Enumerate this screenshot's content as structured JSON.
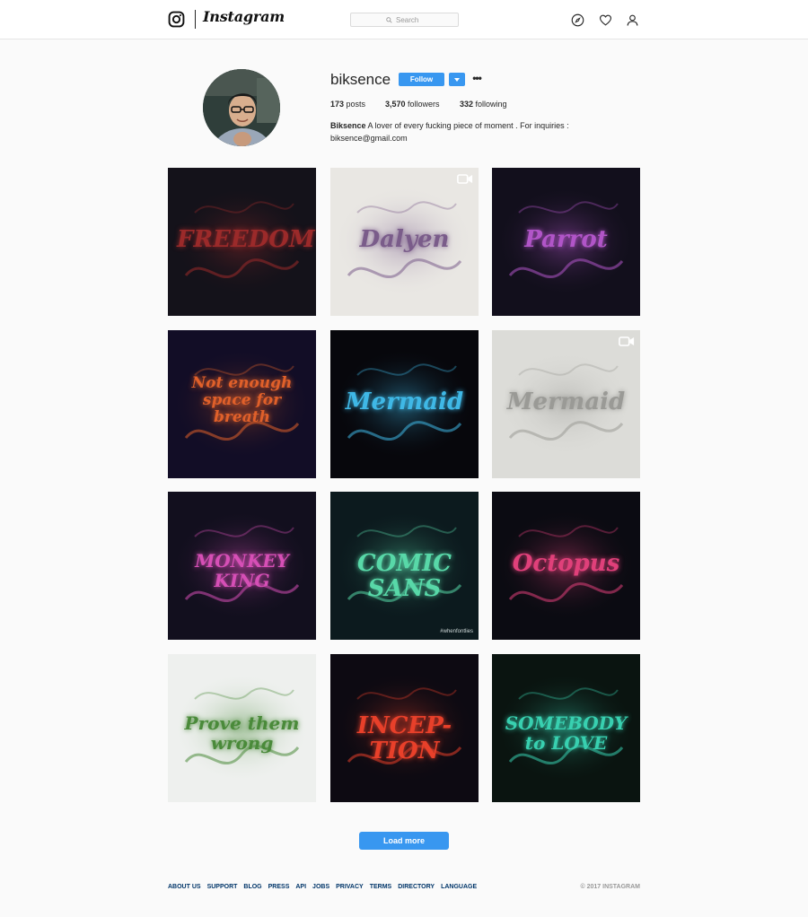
{
  "header": {
    "wordmark": "Instagram",
    "search_placeholder": "Search"
  },
  "profile": {
    "username": "biksence",
    "follow_label": "Follow",
    "more_label": "•••",
    "posts_count": "173",
    "posts_label": " posts",
    "followers_count": "3,570",
    "followers_label": " followers",
    "following_count": "332",
    "following_label": " following",
    "bio_name": "Biksence",
    "bio_text": " A lover of every fucking piece of moment . For inquiries :",
    "bio_email": "biksence@gmail.com"
  },
  "posts": [
    {
      "text": "FREEDOM",
      "bg": "#14121a",
      "color": "#9b2a2a",
      "video": false
    },
    {
      "text": "Dalyen",
      "bg": "#e9e7e3",
      "color": "#7a5c8a",
      "video": true
    },
    {
      "text": "Parrot",
      "bg": "#120f1c",
      "color": "#b155c8",
      "video": false
    },
    {
      "text": "Not enough space for breath",
      "bg": "#120d26",
      "color": "#e0602a",
      "video": false
    },
    {
      "text": "Mermaid",
      "bg": "#07070c",
      "color": "#3fb8e6",
      "video": false
    },
    {
      "text": "Mermaid",
      "bg": "#dcdcd8",
      "color": "#9a9a96",
      "video": true
    },
    {
      "text": "MONKEY KING",
      "bg": "#120f1e",
      "color": "#d64fb6",
      "video": false
    },
    {
      "text": "COMIC SANS",
      "bg": "#0c1a1e",
      "color": "#58d8a8",
      "video": false
    },
    {
      "text": "Octopus",
      "bg": "#0b0b12",
      "color": "#e0407a",
      "video": false
    },
    {
      "text": "Prove them wrong",
      "bg": "#eef0ee",
      "color": "#4a8a3a",
      "video": false
    },
    {
      "text": "INCEP-TION",
      "bg": "#0d0a12",
      "color": "#e8402a",
      "video": false
    },
    {
      "text": "SOMEBODY to LOVE",
      "bg": "#0a1410",
      "color": "#38d0b0",
      "video": false
    }
  ],
  "comic_tag": "#whenfontlies",
  "load_more_label": "Load more",
  "footer": {
    "links": [
      "ABOUT US",
      "SUPPORT",
      "BLOG",
      "PRESS",
      "API",
      "JOBS",
      "PRIVACY",
      "TERMS",
      "DIRECTORY",
      "LANGUAGE"
    ],
    "copyright": "© 2017 INSTAGRAM"
  },
  "colors": {
    "accent": "#3897f0",
    "link": "#003569"
  }
}
